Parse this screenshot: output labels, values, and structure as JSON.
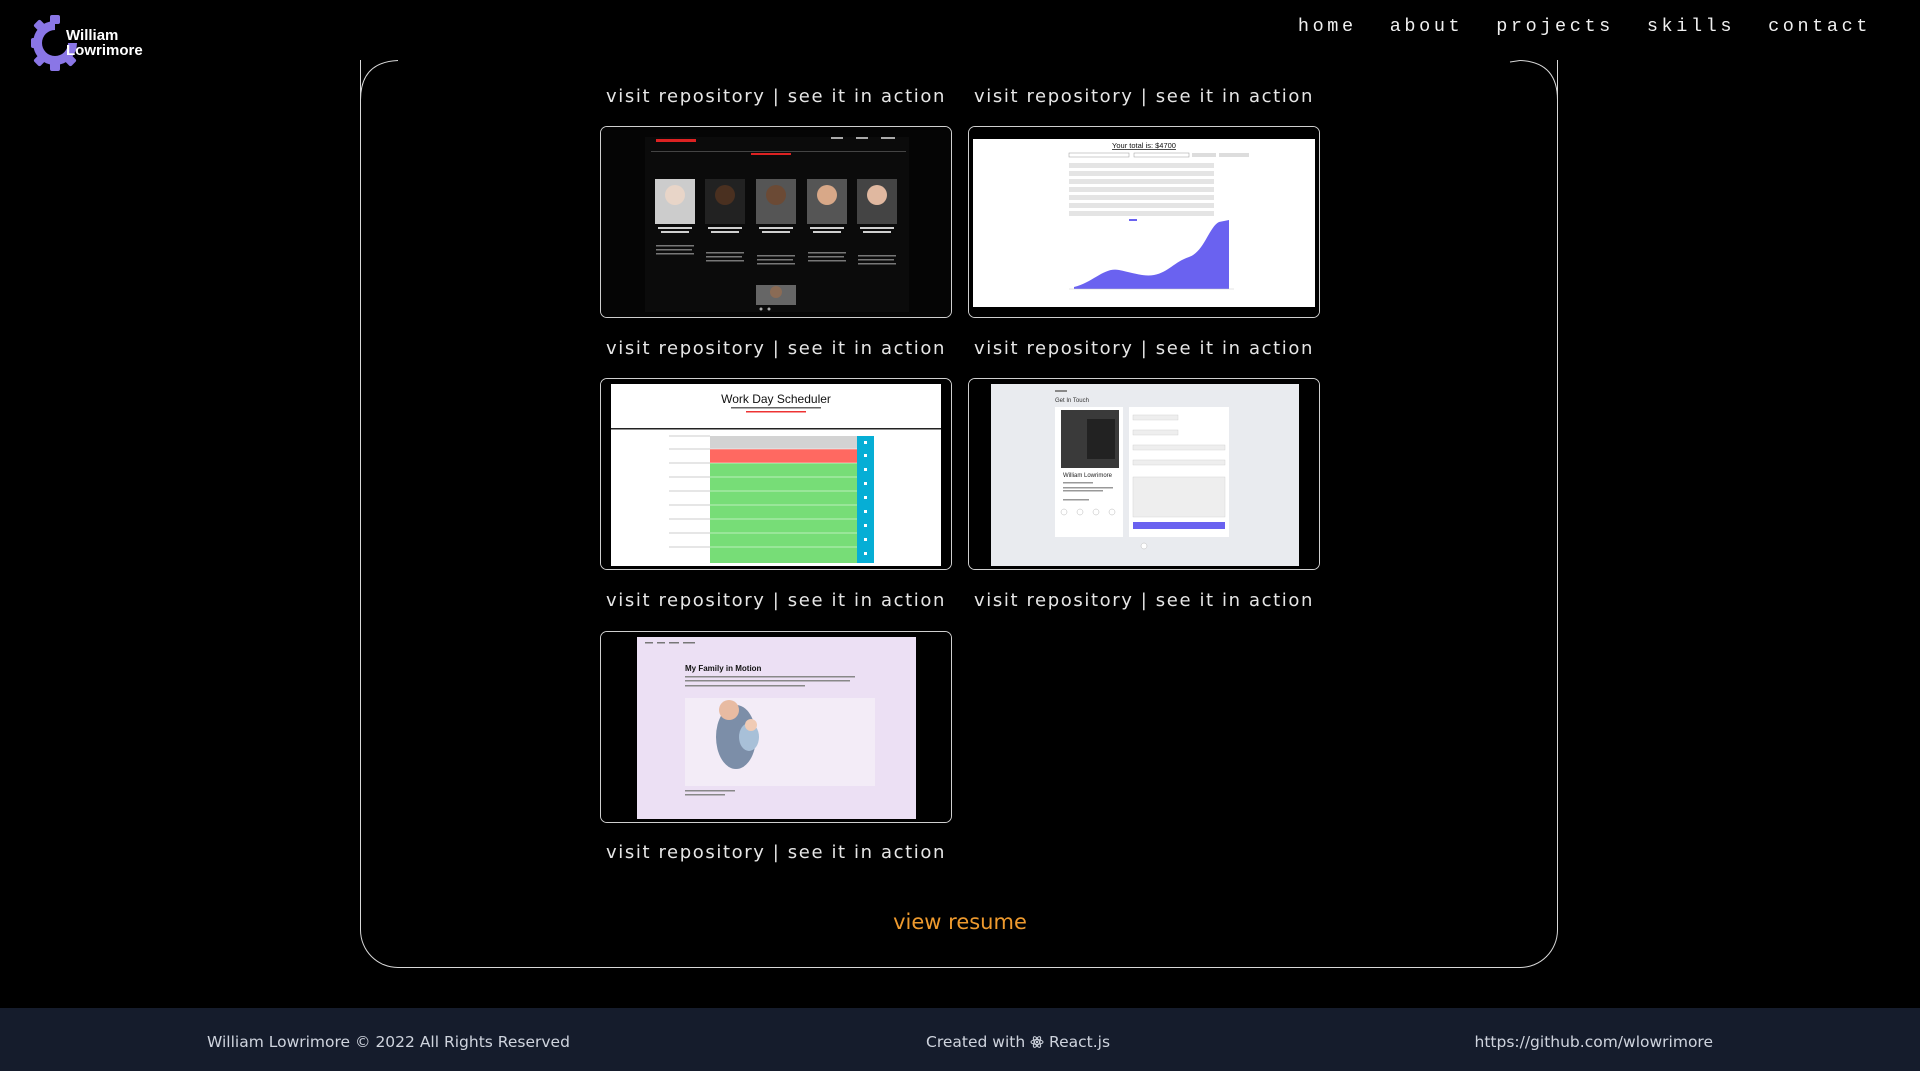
{
  "brand": {
    "first": "William",
    "last": "Lowrimore"
  },
  "nav": [
    "home",
    "about",
    "projects",
    "skills",
    "contact"
  ],
  "projects": {
    "separator": "|",
    "repo_label": "visit repository",
    "demo_label": "see it in action",
    "thumbnails": [
      {
        "title": "Work Day Scheduler"
      },
      {
        "title": "Get In Touch",
        "name": "William Lowrimore"
      },
      {
        "title": "My Family in Motion"
      },
      {
        "title": "Your total is: $4700"
      }
    ]
  },
  "resume_label": "view resume",
  "footer": {
    "copyright": "William Lowrimore © 2022 All Rights Reserved",
    "created_prefix": "Created with",
    "created_icon": "react-icon",
    "created_suffix": "React.js",
    "github": "https://github.com/wlowrimore"
  },
  "colors": {
    "accent": "#ee9a2e",
    "logo": "#7f6be0",
    "footer_bg": "#151c2c",
    "chart": "#6a62f0",
    "scheduler_green": "#77dd77",
    "scheduler_red": "#ff6961",
    "scheduler_blue": "#06aed5"
  }
}
